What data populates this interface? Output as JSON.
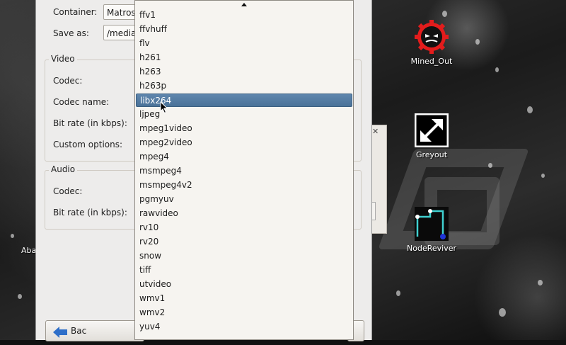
{
  "desktop": {
    "icons": [
      {
        "label": "Mined_Out",
        "icon": "mined-out-icon"
      },
      {
        "label": "Greyout",
        "icon": "greyout-icon"
      },
      {
        "label": "NodeReviver",
        "icon": "nodereviver-icon"
      }
    ],
    "left_partial_label": "Aba"
  },
  "dialog": {
    "container_label": "Container:",
    "container_value": "Matros",
    "saveas_label": "Save as:",
    "saveas_value": "/media",
    "video_group": "Video",
    "video_codec_label": "Codec:",
    "video_codecname_label": "Codec name:",
    "video_bitrate_label": "Bit rate (in kbps):",
    "video_custom_label": "Custom options:",
    "audio_group": "Audio",
    "audio_codec_label": "Codec:",
    "audio_bitrate_label": "Bit rate (in kbps):",
    "back_button": "Bac"
  },
  "dropdown": {
    "selected": "libx264",
    "items": [
      "ffv1",
      "ffvhuff",
      "flv",
      "h261",
      "h263",
      "h263p",
      "libx264",
      "ljpeg",
      "mpeg1video",
      "mpeg2video",
      "mpeg4",
      "msmpeg4",
      "msmpeg4v2",
      "pgmyuv",
      "rawvideo",
      "rv10",
      "rv20",
      "snow",
      "tiff",
      "utvideo",
      "wmv1",
      "wmv2",
      "yuv4"
    ]
  },
  "colors": {
    "selection": "#4f7aa3",
    "dialog_bg": "#edeceb",
    "list_bg": "#f6f4f0"
  }
}
